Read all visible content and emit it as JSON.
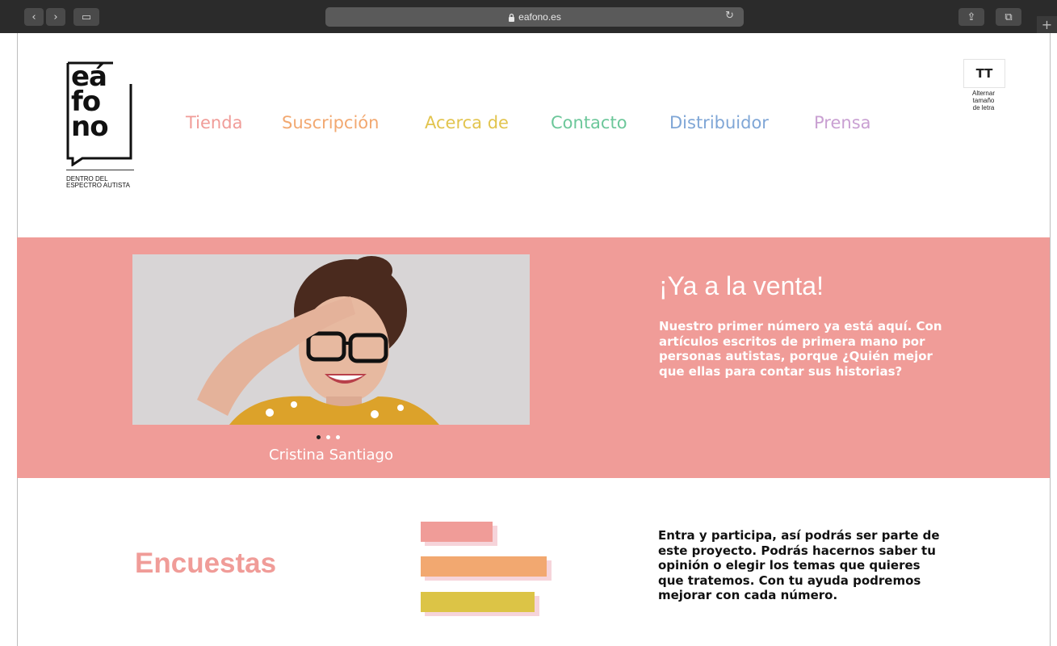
{
  "browser": {
    "url": "eafono.es",
    "lock_icon": "lock-icon",
    "back_label": "‹",
    "forward_label": "›",
    "sidebar_label": "▭",
    "share_label": "⇪",
    "tabs_label": "⧉",
    "reload_label": "↻",
    "new_tab_label": "+"
  },
  "logo": {
    "line1": "eá",
    "line2": "fo",
    "line3": "no",
    "tagline_1": "DENTRO DEL",
    "tagline_2": "ESPECTRO AUTISTA"
  },
  "nav": [
    {
      "label": "Tienda",
      "color": "#f09c98"
    },
    {
      "label": "Suscripción",
      "color": "#f2a870"
    },
    {
      "label": "Acerca de",
      "color": "#e2c44e"
    },
    {
      "label": "Contacto",
      "color": "#6cc79a"
    },
    {
      "label": "Distribuidor",
      "color": "#7fa6d6"
    },
    {
      "label": "Prensa",
      "color": "#c9a0d2"
    }
  ],
  "font_toggle": {
    "icon_text": "TT",
    "label_1": "Alternar",
    "label_2": "tamaño",
    "label_3": "de letra"
  },
  "hero": {
    "background": "#f09c98",
    "caption": "Cristina Santiago",
    "slide_count": 3,
    "active_slide": 1,
    "title": "¡Ya a la venta!",
    "text_1": "Nuestro primer número ya está aquí. Con artículos escritos de primera mano por personas autistas, porque",
    "text_2": "¿Quién mejor que ellas para contar sus historias?"
  },
  "surveys": {
    "title": "Encuestas",
    "bar_colors": [
      "#f09c98",
      "#f2a870",
      "#dcc446"
    ],
    "text": "Entra y participa, así podrás ser parte de este proyecto. Podrás hacernos saber tu opinión o elegir los temas que quieres que tratemos. Con tu ayuda podremos mejorar con cada número."
  }
}
